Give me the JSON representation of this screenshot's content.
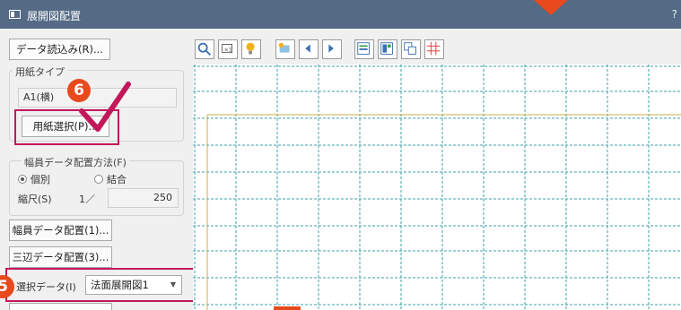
{
  "window": {
    "title": "展開図配置",
    "help": "?"
  },
  "left": {
    "load_button": "データ読込み(R)...",
    "paper": {
      "group_label": "用紙タイプ",
      "value": "A1(横)",
      "select_button": "用紙選択(P)..."
    },
    "layout": {
      "group_label": "幅員データ配置方法(F)",
      "radio_individual": "個別",
      "radio_combine": "結合",
      "selected": "個別",
      "scale_label": "縮尺(S)",
      "scale_prefix": "1／",
      "scale_value": "250"
    },
    "btn_width_data": "幅員データ配置(1)...",
    "btn_side_data": "三辺データ配置(3)...",
    "selected_data": {
      "label": "選択データ(I)",
      "value": "法面展開図1"
    }
  },
  "annotations": {
    "step6": "6",
    "step5": "5"
  },
  "toolbar": {
    "icons": [
      "zoom-icon",
      "fit-icon",
      "lightbulb-icon",
      "pan-icon",
      "prev-icon",
      "next-icon",
      "list-icon",
      "layout-icon",
      "copy-icon",
      "grid-icon"
    ]
  },
  "colors": {
    "titlebar": "#546a85",
    "grid_line": "#3ea0a8",
    "paper_border": "#c9b24a",
    "highlight": "#c2185b",
    "step_badge": "#e8491d"
  }
}
